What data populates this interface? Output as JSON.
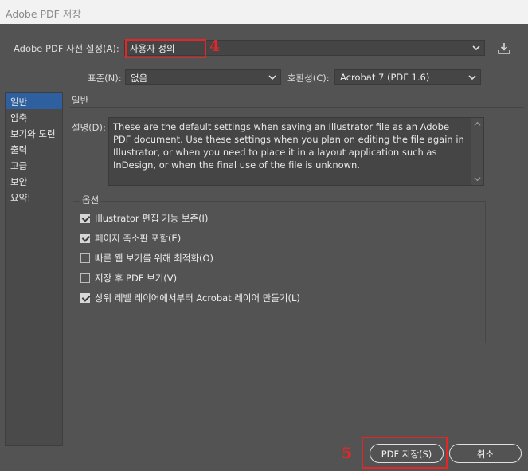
{
  "window": {
    "title": "Adobe PDF 저장"
  },
  "preset": {
    "label": "Adobe PDF 사전 설정(A):",
    "value": "사용자 정의"
  },
  "standard": {
    "label": "표준(N):",
    "value": "없음"
  },
  "compat": {
    "label": "호환성(C):",
    "value": "Acrobat 7 (PDF 1.6)"
  },
  "annotations": {
    "preset_number": "4",
    "save_number": "5",
    "color": "#e52626"
  },
  "sidebar": {
    "items": [
      {
        "label": "일반"
      },
      {
        "label": "압축"
      },
      {
        "label": "보기와 도련"
      },
      {
        "label": "출력"
      },
      {
        "label": "고급"
      },
      {
        "label": "보안"
      },
      {
        "label": "요약!"
      }
    ]
  },
  "general": {
    "title": "일반",
    "description_label": "설명(D):",
    "description": "These are the default settings when saving an Illustrator file as an Adobe PDF document. Use these settings when you plan on editing the file again in Illustrator, or when you need to place it in a layout application such as InDesign, or when the final use of the file is unknown."
  },
  "options": {
    "title": "옵션",
    "items": [
      {
        "label": "Illustrator 편집 기능 보존(I)",
        "checked": true
      },
      {
        "label": "페이지 축소판 포함(E)",
        "checked": true
      },
      {
        "label": "빠른 웹 보기를 위해 최적화(O)",
        "checked": false
      },
      {
        "label": "저장 후 PDF 보기(V)",
        "checked": false
      },
      {
        "label": "상위 레벨 레이어에서부터 Acrobat 레이어 만들기(L)",
        "checked": true
      }
    ]
  },
  "buttons": {
    "save": "PDF 저장(S)",
    "cancel": "취소"
  },
  "icons": {
    "save_preset": "save-preset-icon",
    "chevron": "chevron-down-icon"
  },
  "colors": {
    "dialog_bg": "#535353",
    "field_bg": "#454545",
    "sidebar_selected": "#2e5f9e"
  }
}
